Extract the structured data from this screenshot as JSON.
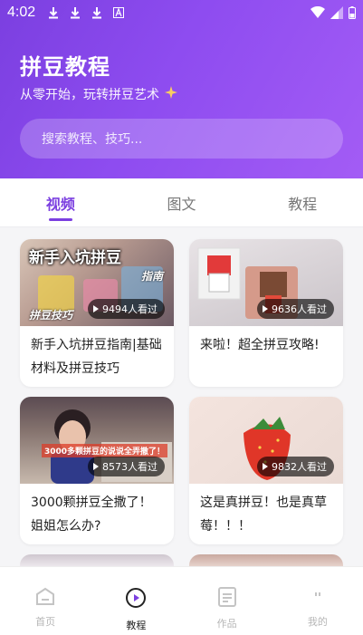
{
  "statusbar": {
    "time": "4:02"
  },
  "header": {
    "title": "拼豆教程",
    "subtitle": "从零开始，玩转拼豆艺术",
    "search_placeholder": "搜索教程、技巧..."
  },
  "tabs": [
    {
      "label": "视频",
      "active": true
    },
    {
      "label": "图文",
      "active": false
    },
    {
      "label": "教程",
      "active": false
    }
  ],
  "cards": [
    {
      "title": "新手入坑拼豆指南|基础材料及拼豆技巧",
      "views": "9494人看过",
      "thumb_text": [
        "新手入坑拼豆",
        "指南",
        "拼豆技巧"
      ]
    },
    {
      "title": "来啦！超全拼豆攻略!",
      "views": "9636人看过"
    },
    {
      "title": "3000颗拼豆全撒了！姐姐怎么办?",
      "views": "8573人看过",
      "thumb_text": [
        "3000多颗拼豆的说说全弄撒了！"
      ]
    },
    {
      "title": "这是真拼豆！也是真草莓！！！",
      "views": "9832人看过"
    }
  ],
  "bottom_nav": [
    {
      "label": "首页",
      "icon": "home-icon",
      "active": false
    },
    {
      "label": "教程",
      "icon": "play-circle-icon",
      "active": true
    },
    {
      "label": "作品",
      "icon": "document-icon",
      "active": false
    },
    {
      "label": "我的",
      "icon": "profile-icon",
      "active": false
    }
  ],
  "colors": {
    "accent": "#7b3fe0",
    "header_gradient_end": "#a35cf5"
  }
}
